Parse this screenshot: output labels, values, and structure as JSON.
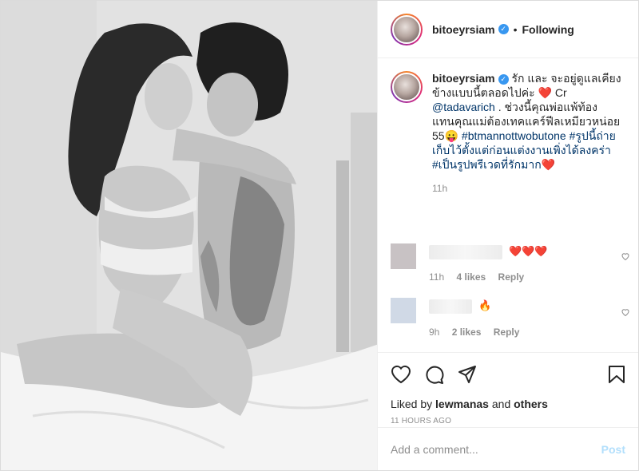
{
  "header": {
    "username": "bitoeyrsiam",
    "verified_glyph": "✓",
    "separator": "•",
    "follow_status": "Following"
  },
  "caption": {
    "username": "bitoeyrsiam",
    "text_1": "รัก และ จะอยู่ดูแลเคียงข้างแบบนี้ตลอดไปค่ะ ❤️ Cr ",
    "mention": "@tadavarich",
    "text_2": " . ช่วงนี้คุณพ่อแพ้ท้องแทนคุณแม่ต้องเทคแคร์ฟีลเหมียวหน่อย 55😛 ",
    "hashtag_1": "#btmannottwobutone",
    "hashtag_2": "#รูปนี้ถ่ายเก็บไว้ตั้งแต่ก่อนแต่งงานเพิ่งได้ลงคร่า",
    "hashtag_3": "#เป็นรูปพรีเวดที่รักมาก❤️",
    "time": "11h"
  },
  "comments": [
    {
      "text": "❤️❤️❤️",
      "time": "11h",
      "likes": "4 likes",
      "reply": "Reply"
    },
    {
      "text": "🔥",
      "time": "9h",
      "likes": "2 likes",
      "reply": "Reply"
    }
  ],
  "actions": {
    "liked_prefix": "Liked by ",
    "liked_user": "lewmanas",
    "liked_and": " and ",
    "liked_others": "others",
    "timestamp": "11 HOURS AGO"
  },
  "add_comment": {
    "placeholder": "Add a comment...",
    "post_label": "Post"
  },
  "colors": {
    "link": "#003569",
    "verified": "#3897f0",
    "post_disabled": "#b2dffc",
    "heart": "#ed4956"
  }
}
